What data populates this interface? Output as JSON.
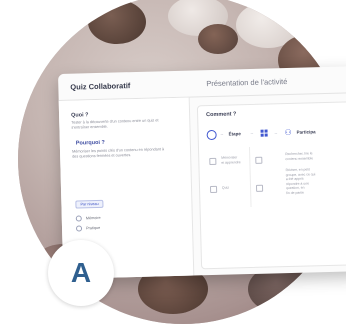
{
  "app": {
    "title": "Quiz Collaboratif",
    "activity_title": "Présentation de l'activité"
  },
  "left_panel": {
    "quoi_heading": "Quoi ?",
    "quoi_text": "Tester à la découverte d'un contenu entre un quiz et s'entraîner ensemble.",
    "pourquoi_heading": "Pourquoi ?",
    "pourquoi_text": "Mémoriser les points clés d'un contenu en répondant à des questions fermées et ouvertes.",
    "chip_label": "Par niveau",
    "list": [
      {
        "label": "Mémoire"
      },
      {
        "label": "Pratique"
      }
    ]
  },
  "right_panel": {
    "heading": "Comment ?",
    "steps": [
      {
        "label": "Étape",
        "icon": "clock-icon"
      },
      {
        "label": "",
        "icon": "grid-icon"
      },
      {
        "label": "Participa",
        "icon": "people-icon"
      }
    ],
    "col1": [
      "Mémoriser",
      "et apprendre"
    ],
    "col2": [
      "Quiz"
    ],
    "col3": [
      "Rechercher, lire le",
      "contenu ensemble"
    ],
    "col4": [
      "Réviser, en petit",
      "groupe, avec ce qui",
      "a été appris",
      "répondre à une",
      "question, en",
      "fin de partie"
    ]
  },
  "badge": {
    "letter": "A"
  },
  "colors": {
    "accent": "#4158d0",
    "badge_text": "#2f5f8f"
  }
}
